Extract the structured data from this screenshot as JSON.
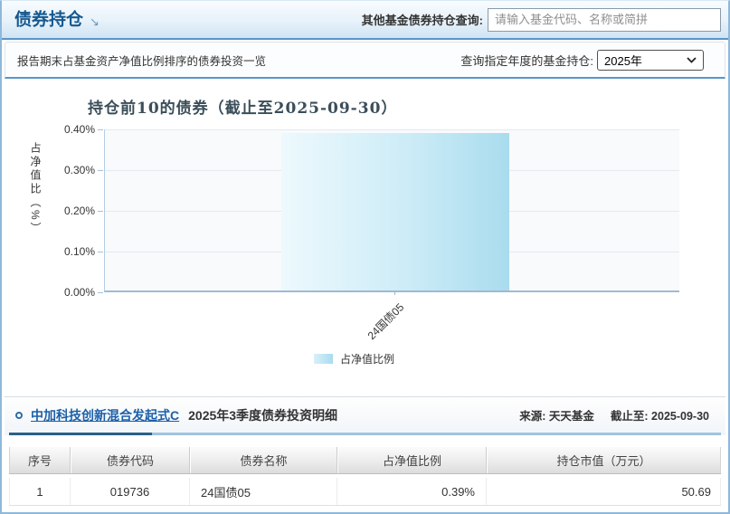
{
  "page": {
    "title": "债券持仓",
    "title_arrow": "↘"
  },
  "header": {
    "search_label": "其他基金债券持仓查询:",
    "search_placeholder": "请输入基金代码、名称或简拼"
  },
  "subbar": {
    "description": "报告期末占基金资产净值比例排序的债券投资一览",
    "year_label": "查询指定年度的基金持仓:",
    "year_selected": "2025年"
  },
  "chart_data": {
    "type": "bar",
    "title": "持仓前10的债券（截止至2025-09-30）",
    "categories": [
      "24国债05"
    ],
    "series": [
      {
        "name": "占净值比例",
        "values": [
          0.39
        ]
      }
    ],
    "ylabel": "占净值比（%）",
    "ylim": [
      0,
      0.4
    ],
    "yticks": [
      "0.40%",
      "0.30%",
      "0.20%",
      "0.10%",
      "0.00%"
    ],
    "legend_position": "bottom",
    "grid": true,
    "bar_color_gradient": [
      "#edf9fd",
      "#a9dcee"
    ]
  },
  "detail": {
    "fund_link": "中加科技创新混合发起式C",
    "subtitle": "2025年3季度债券投资明细",
    "source": "来源: 天天基金",
    "as_of": "截止至: 2025-09-30"
  },
  "table": {
    "headers": [
      "序号",
      "债券代码",
      "债券名称",
      "占净值比例",
      "持仓市值（万元）"
    ],
    "rows": [
      [
        "1",
        "019736",
        "24国债05",
        "0.39%",
        "50.69"
      ]
    ]
  }
}
